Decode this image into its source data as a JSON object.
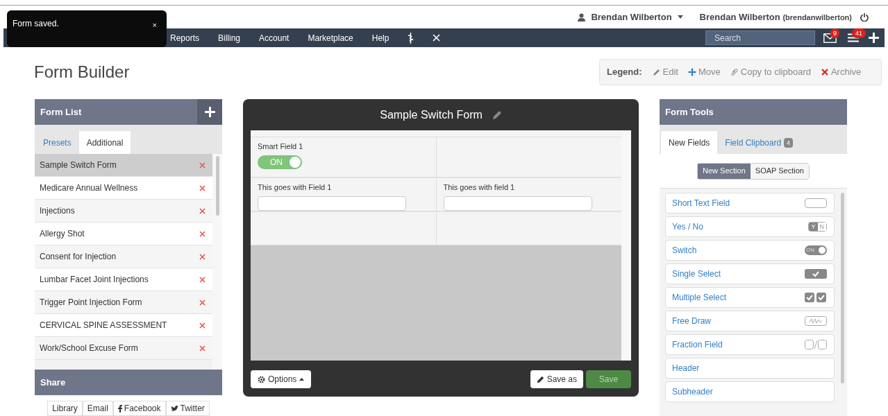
{
  "user_menu": {
    "name": "Brendan Wilberton",
    "account_name": "Brendan Wilberton",
    "account_handle": "(brendanwilberton)"
  },
  "toast": {
    "message": "Form saved.",
    "close": "×"
  },
  "nav": {
    "items": [
      {
        "label": "Reports",
        "kind": "text"
      },
      {
        "label": "Billing",
        "kind": "text"
      },
      {
        "label": "Account",
        "kind": "text"
      },
      {
        "label": "Marketplace",
        "kind": "text"
      },
      {
        "label": "Help",
        "kind": "text"
      },
      {
        "kind": "staff"
      },
      {
        "kind": "close"
      }
    ],
    "search": {
      "placeholder": "Search"
    },
    "messages_badge": "9",
    "tasks_badge": "41"
  },
  "page_title": "Form Builder",
  "legend": {
    "title": "Legend:",
    "items": [
      {
        "label": "Edit",
        "kind": "edit"
      },
      {
        "label": "Move",
        "kind": "move"
      },
      {
        "label": "Copy to clipboard",
        "kind": "copy"
      },
      {
        "label": "Archive",
        "kind": "archive"
      }
    ]
  },
  "form_list": {
    "title": "Form List",
    "tabs": [
      {
        "label": "Presets",
        "selected": false
      },
      {
        "label": "Additional",
        "selected": true
      }
    ],
    "items": [
      {
        "name": "Sample Switch Form",
        "selected": true
      },
      {
        "name": "Medicare Annual Wellness",
        "selected": false
      },
      {
        "name": "Injections",
        "selected": false
      },
      {
        "name": "Allergy Shot",
        "selected": false
      },
      {
        "name": "Consent for Injection",
        "selected": false
      },
      {
        "name": "Lumbar Facet Joint Injections",
        "selected": false
      },
      {
        "name": "Trigger Point Injection Form",
        "selected": false
      },
      {
        "name": "CERVICAL SPINE ASSESSMENT",
        "selected": false
      },
      {
        "name": "Work/School Excuse Form",
        "selected": false
      }
    ]
  },
  "share": {
    "title": "Share",
    "buttons": [
      {
        "label": "Library",
        "kind": "text"
      },
      {
        "label": "Email",
        "kind": "text"
      },
      {
        "label": "Facebook",
        "kind": "facebook"
      },
      {
        "label": "Twitter",
        "kind": "twitter"
      }
    ]
  },
  "editor": {
    "title": "Sample Switch Form",
    "rows": [
      [
        {
          "label": "Smart Field 1",
          "kind": "switch",
          "on": true,
          "switch_text": "ON"
        },
        {
          "kind": "empty"
        }
      ],
      [
        {
          "label": "This goes with Field 1",
          "kind": "text"
        },
        {
          "label": "This goes with field 1",
          "kind": "text"
        }
      ],
      [
        {
          "kind": "empty"
        },
        {
          "kind": "empty"
        }
      ]
    ],
    "options_button": "Options",
    "save_as_button": "Save as",
    "save_button": "Save"
  },
  "form_tools": {
    "title": "Form Tools",
    "tabs": [
      {
        "label": "New Fields",
        "selected": true
      },
      {
        "label": "Field Clipboard",
        "selected": false,
        "badge": "4"
      }
    ],
    "sections": [
      {
        "label": "New Section",
        "selected": true
      },
      {
        "label": "SOAP Section",
        "selected": false
      }
    ],
    "fields": [
      {
        "label": "Short Text Field",
        "kind": "text"
      },
      {
        "label": "Yes / No",
        "kind": "yesno",
        "preview": [
          "Y",
          "N"
        ]
      },
      {
        "label": "Switch",
        "kind": "switch",
        "preview": [
          "ON"
        ]
      },
      {
        "label": "Single Select",
        "kind": "single"
      },
      {
        "label": "Multiple Select",
        "kind": "multi"
      },
      {
        "label": "Free Draw",
        "kind": "draw"
      },
      {
        "label": "Fraction Field",
        "kind": "fraction"
      },
      {
        "label": "Header",
        "kind": "plain"
      },
      {
        "label": "Subheader",
        "kind": "plain"
      }
    ]
  }
}
